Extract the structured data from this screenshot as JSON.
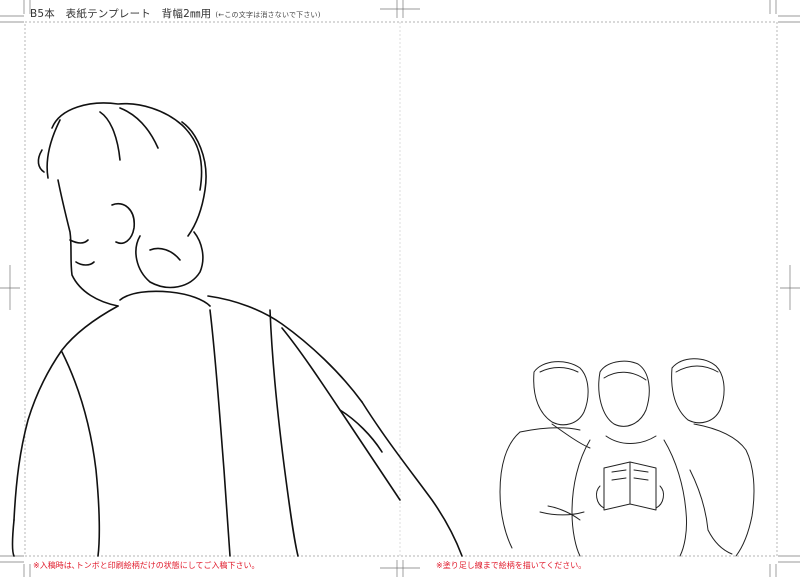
{
  "header": {
    "title": "B5本　表紙テンプレート　背幅2㎜用",
    "note": "(←この文字は消さないで下さい)"
  },
  "footer": {
    "left_note": "※入稿時は､トンボと印刷絵柄だけの状態にしてご入稿下さい｡",
    "right_note": "※塗り足し線まで絵柄を描いてください｡"
  },
  "colors": {
    "note_red": "#e0192a",
    "guide_gray": "#9a9a9a",
    "line_ink": "#111111"
  }
}
